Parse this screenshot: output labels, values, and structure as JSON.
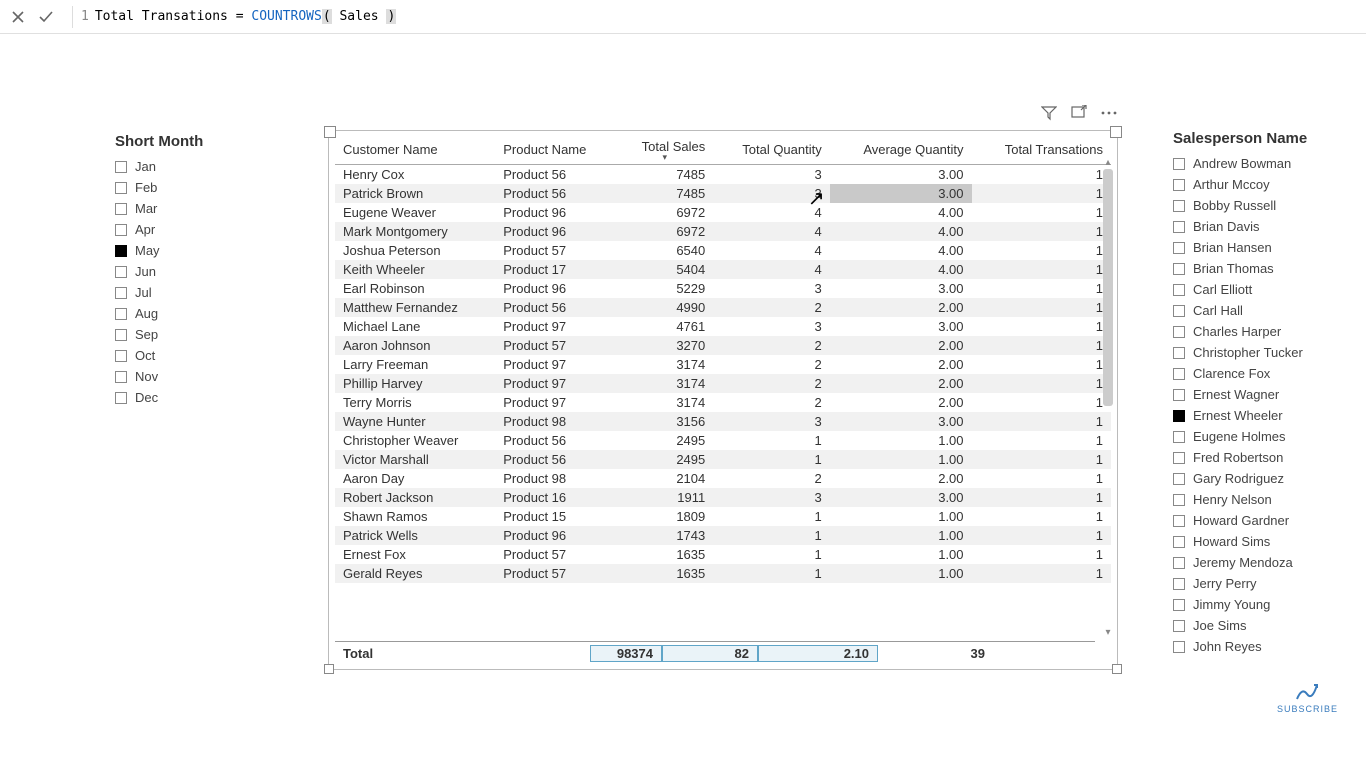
{
  "formula_bar": {
    "line_no": "1",
    "measure_name": "Total Transations",
    "equals": " = ",
    "function": "COUNTROWS",
    "open_paren": "(",
    "table_ref": " Sales ",
    "close_paren": ")"
  },
  "month_slicer": {
    "title": "Short Month",
    "items": [
      {
        "label": "Jan",
        "selected": false
      },
      {
        "label": "Feb",
        "selected": false
      },
      {
        "label": "Mar",
        "selected": false
      },
      {
        "label": "Apr",
        "selected": false
      },
      {
        "label": "May",
        "selected": true
      },
      {
        "label": "Jun",
        "selected": false
      },
      {
        "label": "Jul",
        "selected": false
      },
      {
        "label": "Aug",
        "selected": false
      },
      {
        "label": "Sep",
        "selected": false
      },
      {
        "label": "Oct",
        "selected": false
      },
      {
        "label": "Nov",
        "selected": false
      },
      {
        "label": "Dec",
        "selected": false
      }
    ]
  },
  "salesperson_slicer": {
    "title": "Salesperson Name",
    "items": [
      {
        "label": "Andrew Bowman",
        "selected": false
      },
      {
        "label": "Arthur Mccoy",
        "selected": false
      },
      {
        "label": "Bobby Russell",
        "selected": false
      },
      {
        "label": "Brian Davis",
        "selected": false
      },
      {
        "label": "Brian Hansen",
        "selected": false
      },
      {
        "label": "Brian Thomas",
        "selected": false
      },
      {
        "label": "Carl Elliott",
        "selected": false
      },
      {
        "label": "Carl Hall",
        "selected": false
      },
      {
        "label": "Charles Harper",
        "selected": false
      },
      {
        "label": "Christopher Tucker",
        "selected": false
      },
      {
        "label": "Clarence Fox",
        "selected": false
      },
      {
        "label": "Ernest Wagner",
        "selected": false
      },
      {
        "label": "Ernest Wheeler",
        "selected": true
      },
      {
        "label": "Eugene Holmes",
        "selected": false
      },
      {
        "label": "Fred Robertson",
        "selected": false
      },
      {
        "label": "Gary Rodriguez",
        "selected": false
      },
      {
        "label": "Henry Nelson",
        "selected": false
      },
      {
        "label": "Howard Gardner",
        "selected": false
      },
      {
        "label": "Howard Sims",
        "selected": false
      },
      {
        "label": "Jeremy Mendoza",
        "selected": false
      },
      {
        "label": "Jerry Perry",
        "selected": false
      },
      {
        "label": "Jimmy Young",
        "selected": false
      },
      {
        "label": "Joe Sims",
        "selected": false
      },
      {
        "label": "John Reyes",
        "selected": false
      }
    ]
  },
  "table": {
    "columns": [
      "Customer Name",
      "Product Name",
      "Total Sales",
      "Total Quantity",
      "Average Quantity",
      "Total Transations"
    ],
    "sorted_column_index": 2,
    "rows": [
      {
        "customer": "Henry Cox",
        "product": "Product 56",
        "sales": "7485",
        "qty": "3",
        "avg": "3.00",
        "trans": "1"
      },
      {
        "customer": "Patrick Brown",
        "product": "Product 56",
        "sales": "7485",
        "qty": "3",
        "avg": "3.00",
        "trans": "1",
        "hover": true
      },
      {
        "customer": "Eugene Weaver",
        "product": "Product 96",
        "sales": "6972",
        "qty": "4",
        "avg": "4.00",
        "trans": "1"
      },
      {
        "customer": "Mark Montgomery",
        "product": "Product 96",
        "sales": "6972",
        "qty": "4",
        "avg": "4.00",
        "trans": "1"
      },
      {
        "customer": "Joshua Peterson",
        "product": "Product 57",
        "sales": "6540",
        "qty": "4",
        "avg": "4.00",
        "trans": "1"
      },
      {
        "customer": "Keith Wheeler",
        "product": "Product 17",
        "sales": "5404",
        "qty": "4",
        "avg": "4.00",
        "trans": "1"
      },
      {
        "customer": "Earl Robinson",
        "product": "Product 96",
        "sales": "5229",
        "qty": "3",
        "avg": "3.00",
        "trans": "1"
      },
      {
        "customer": "Matthew Fernandez",
        "product": "Product 56",
        "sales": "4990",
        "qty": "2",
        "avg": "2.00",
        "trans": "1"
      },
      {
        "customer": "Michael Lane",
        "product": "Product 97",
        "sales": "4761",
        "qty": "3",
        "avg": "3.00",
        "trans": "1"
      },
      {
        "customer": "Aaron Johnson",
        "product": "Product 57",
        "sales": "3270",
        "qty": "2",
        "avg": "2.00",
        "trans": "1"
      },
      {
        "customer": "Larry Freeman",
        "product": "Product 97",
        "sales": "3174",
        "qty": "2",
        "avg": "2.00",
        "trans": "1"
      },
      {
        "customer": "Phillip Harvey",
        "product": "Product 97",
        "sales": "3174",
        "qty": "2",
        "avg": "2.00",
        "trans": "1"
      },
      {
        "customer": "Terry Morris",
        "product": "Product 97",
        "sales": "3174",
        "qty": "2",
        "avg": "2.00",
        "trans": "1"
      },
      {
        "customer": "Wayne Hunter",
        "product": "Product 98",
        "sales": "3156",
        "qty": "3",
        "avg": "3.00",
        "trans": "1"
      },
      {
        "customer": "Christopher Weaver",
        "product": "Product 56",
        "sales": "2495",
        "qty": "1",
        "avg": "1.00",
        "trans": "1"
      },
      {
        "customer": "Victor Marshall",
        "product": "Product 56",
        "sales": "2495",
        "qty": "1",
        "avg": "1.00",
        "trans": "1"
      },
      {
        "customer": "Aaron Day",
        "product": "Product 98",
        "sales": "2104",
        "qty": "2",
        "avg": "2.00",
        "trans": "1"
      },
      {
        "customer": "Robert Jackson",
        "product": "Product 16",
        "sales": "1911",
        "qty": "3",
        "avg": "3.00",
        "trans": "1"
      },
      {
        "customer": "Shawn Ramos",
        "product": "Product 15",
        "sales": "1809",
        "qty": "1",
        "avg": "1.00",
        "trans": "1"
      },
      {
        "customer": "Patrick Wells",
        "product": "Product 96",
        "sales": "1743",
        "qty": "1",
        "avg": "1.00",
        "trans": "1"
      },
      {
        "customer": "Ernest Fox",
        "product": "Product 57",
        "sales": "1635",
        "qty": "1",
        "avg": "1.00",
        "trans": "1"
      },
      {
        "customer": "Gerald Reyes",
        "product": "Product 57",
        "sales": "1635",
        "qty": "1",
        "avg": "1.00",
        "trans": "1"
      }
    ],
    "totals": {
      "label": "Total",
      "sales": "98374",
      "qty": "82",
      "avg": "2.10",
      "trans": "39"
    }
  },
  "subscribe_label": "SUBSCRIBE"
}
